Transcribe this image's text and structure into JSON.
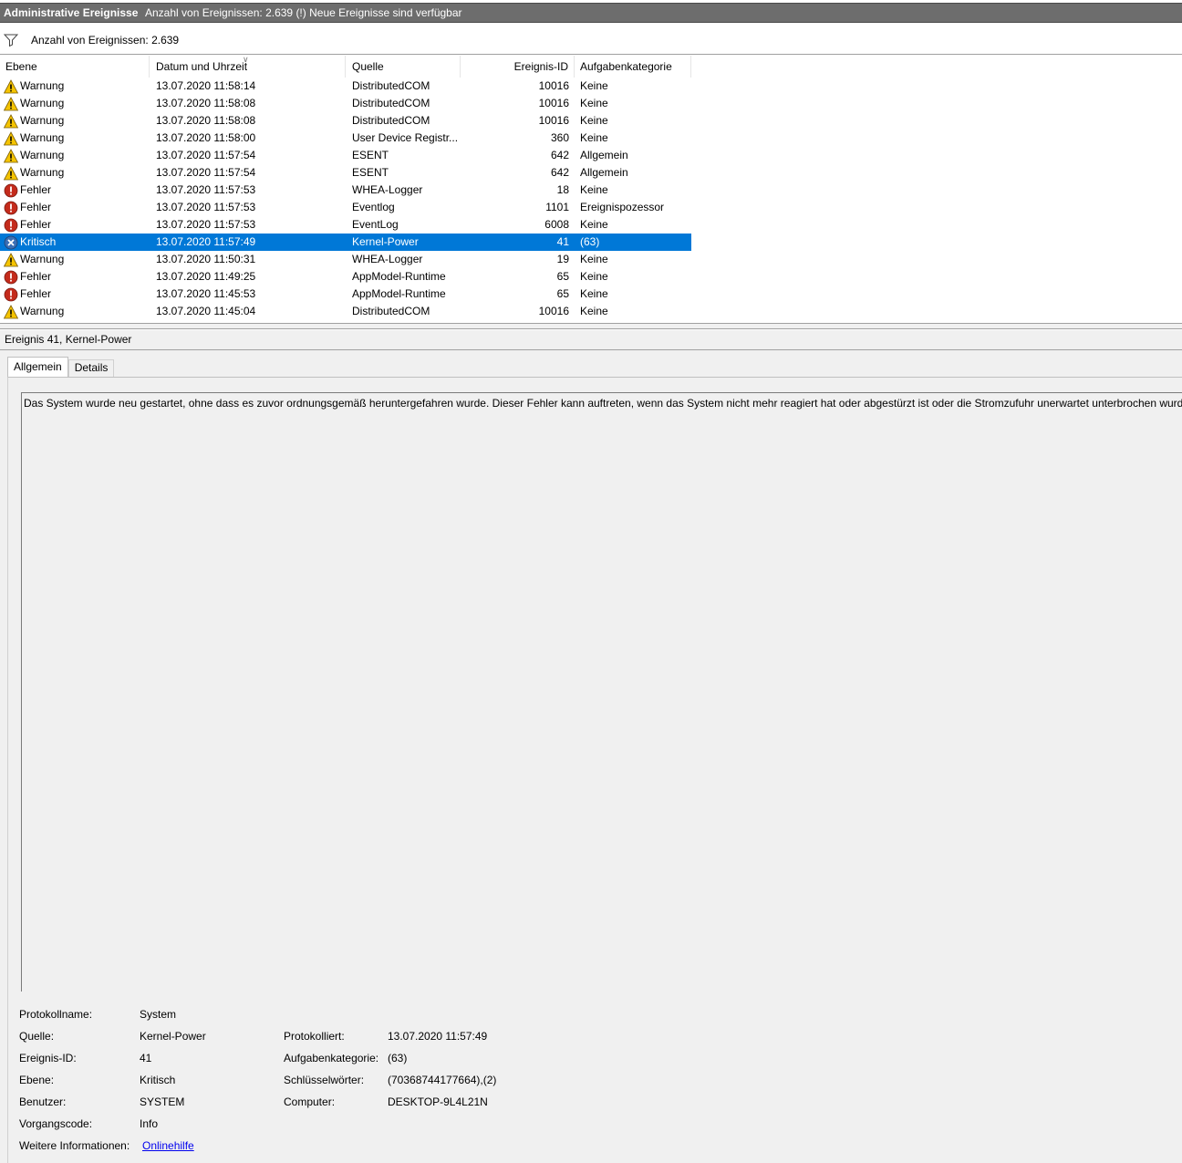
{
  "titlebar": {
    "title": "Administrative Ereignisse",
    "status": "Anzahl von Ereignissen: 2.639 (!) Neue Ereignisse sind verfügbar"
  },
  "filterbar": {
    "icon": "filter-icon",
    "text": "Anzahl von Ereignissen: 2.639"
  },
  "grid": {
    "columns": {
      "level": "Ebene",
      "date": "Datum und Uhrzeit",
      "source": "Quelle",
      "id": "Ereignis-ID",
      "category": "Aufgabenkategorie"
    },
    "rows": [
      {
        "level": "Warnung",
        "icon": "warning-icon",
        "date": "13.07.2020 11:58:14",
        "source": "DistributedCOM",
        "id": "10016",
        "category": "Keine"
      },
      {
        "level": "Warnung",
        "icon": "warning-icon",
        "date": "13.07.2020 11:58:08",
        "source": "DistributedCOM",
        "id": "10016",
        "category": "Keine"
      },
      {
        "level": "Warnung",
        "icon": "warning-icon",
        "date": "13.07.2020 11:58:08",
        "source": "DistributedCOM",
        "id": "10016",
        "category": "Keine"
      },
      {
        "level": "Warnung",
        "icon": "warning-icon",
        "date": "13.07.2020 11:58:00",
        "source": "User Device Registr...",
        "id": "360",
        "category": "Keine"
      },
      {
        "level": "Warnung",
        "icon": "warning-icon",
        "date": "13.07.2020 11:57:54",
        "source": "ESENT",
        "id": "642",
        "category": "Allgemein"
      },
      {
        "level": "Warnung",
        "icon": "warning-icon",
        "date": "13.07.2020 11:57:54",
        "source": "ESENT",
        "id": "642",
        "category": "Allgemein"
      },
      {
        "level": "Fehler",
        "icon": "error-icon",
        "date": "13.07.2020 11:57:53",
        "source": "WHEA-Logger",
        "id": "18",
        "category": "Keine"
      },
      {
        "level": "Fehler",
        "icon": "error-icon",
        "date": "13.07.2020 11:57:53",
        "source": "Eventlog",
        "id": "1101",
        "category": "Ereignispozessor"
      },
      {
        "level": "Fehler",
        "icon": "error-icon",
        "date": "13.07.2020 11:57:53",
        "source": "EventLog",
        "id": "6008",
        "category": "Keine"
      },
      {
        "level": "Kritisch",
        "icon": "critical-icon",
        "date": "13.07.2020 11:57:49",
        "source": "Kernel-Power",
        "id": "41",
        "category": "(63)",
        "selected": true
      },
      {
        "level": "Warnung",
        "icon": "warning-icon",
        "date": "13.07.2020 11:50:31",
        "source": "WHEA-Logger",
        "id": "19",
        "category": "Keine"
      },
      {
        "level": "Fehler",
        "icon": "error-icon",
        "date": "13.07.2020 11:49:25",
        "source": "AppModel-Runtime",
        "id": "65",
        "category": "Keine"
      },
      {
        "level": "Fehler",
        "icon": "error-icon",
        "date": "13.07.2020 11:45:53",
        "source": "AppModel-Runtime",
        "id": "65",
        "category": "Keine"
      },
      {
        "level": "Warnung",
        "icon": "warning-icon",
        "date": "13.07.2020 11:45:04",
        "source": "DistributedCOM",
        "id": "10016",
        "category": "Keine"
      }
    ]
  },
  "detail": {
    "header": "Ereignis 41, Kernel-Power",
    "tabs": [
      "Allgemein",
      "Details"
    ],
    "message": "Das System wurde neu gestartet, ohne dass es zuvor ordnungsgemäß heruntergefahren wurde. Dieser Fehler kann auftreten, wenn das System nicht mehr reagiert hat oder abgestürzt ist oder die Stromzufuhr unerwartet unterbrochen wurde.",
    "props": {
      "logname_label": "Protokollname:",
      "logname": "System",
      "source_label": "Quelle:",
      "source": "Kernel-Power",
      "logged_label": "Protokolliert:",
      "logged": "13.07.2020 11:57:49",
      "eventid_label": "Ereignis-ID:",
      "eventid": "41",
      "category_label": "Aufgabenkategorie:",
      "category": "(63)",
      "level_label": "Ebene:",
      "level": "Kritisch",
      "keywords_label": "Schlüsselwörter:",
      "keywords": "(70368744177664),(2)",
      "user_label": "Benutzer:",
      "user": "SYSTEM",
      "computer_label": "Computer:",
      "computer": "DESKTOP-9L4L21N",
      "opcode_label": "Vorgangscode:",
      "opcode": "Info",
      "moreinfo_label": "Weitere Informationen:",
      "moreinfo_link": "Onlinehilfe"
    }
  },
  "colors": {
    "selection": "#0078d7",
    "titlebar": "#6d6d6d",
    "warning": "#f5c400",
    "error": "#c42b1c",
    "critical": "#3a6fb5"
  }
}
